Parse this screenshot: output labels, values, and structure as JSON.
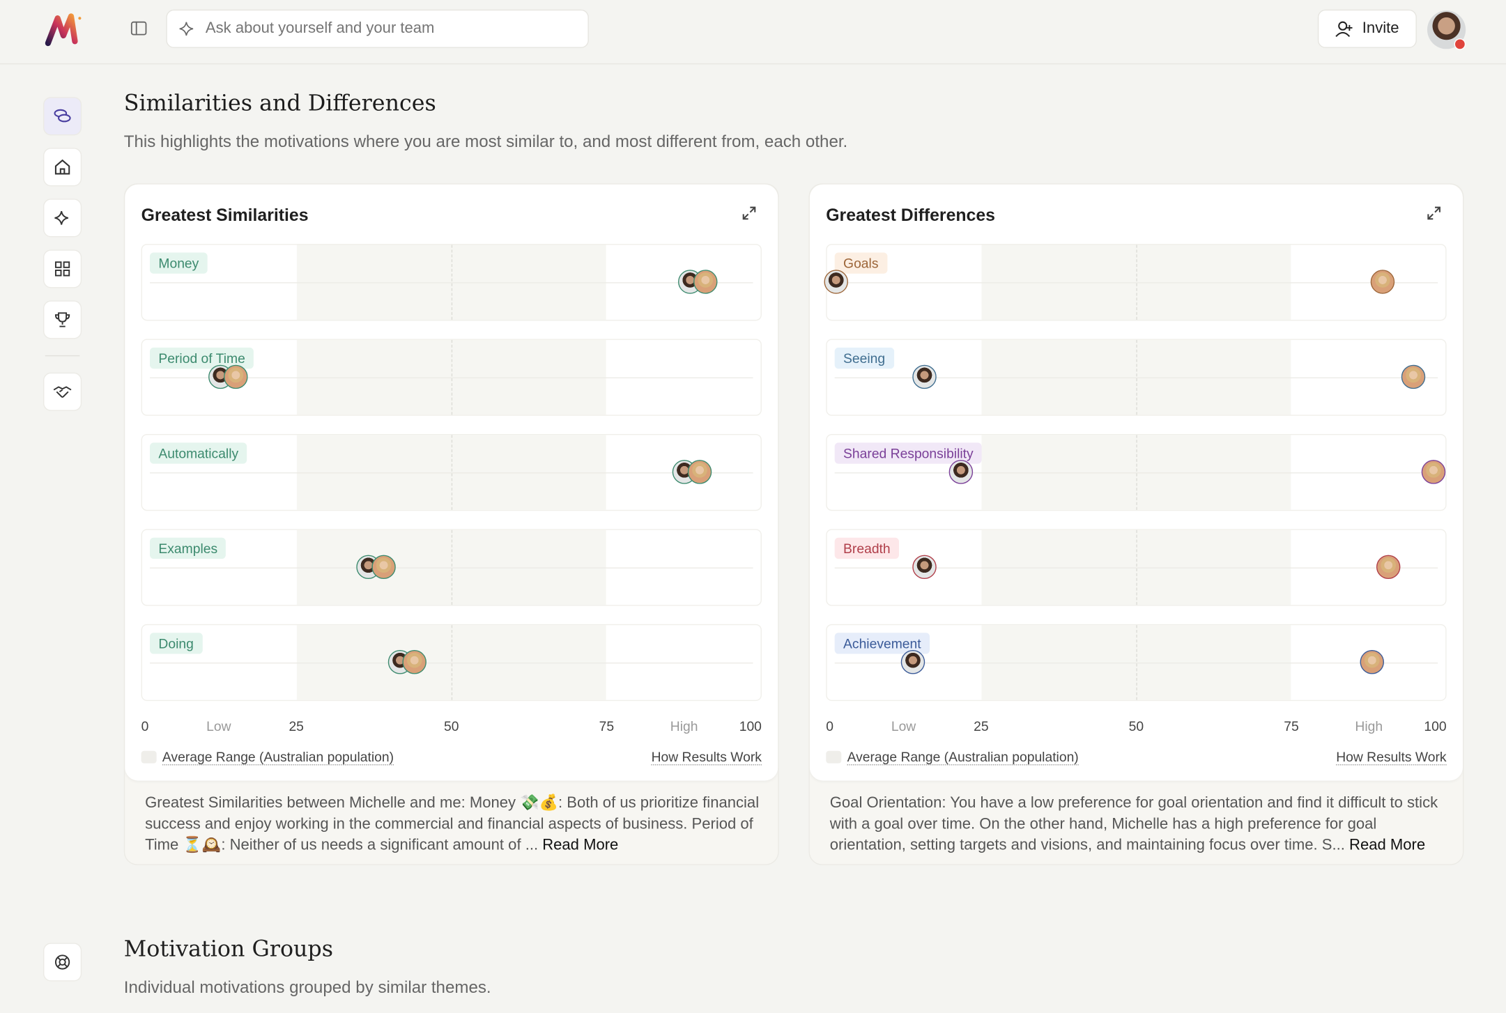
{
  "header": {
    "search_placeholder": "Ask about yourself and your team",
    "invite_label": "Invite"
  },
  "sidebar": {
    "items": [
      {
        "icon": "coins-icon",
        "active": true
      },
      {
        "icon": "home-icon"
      },
      {
        "icon": "sparkle-icon"
      },
      {
        "icon": "grid-icon"
      },
      {
        "icon": "trophy-icon"
      },
      {
        "icon": "handshake-icon"
      },
      {
        "icon": "lifebuoy-icon"
      }
    ]
  },
  "section": {
    "title": "Similarities and Differences",
    "subtitle": "This highlights the motivations where you are most similar to, and most different from, each other."
  },
  "axis": {
    "labels": [
      {
        "text": "0",
        "v": 0
      },
      {
        "text": "Low",
        "v": 12.5,
        "muted": true
      },
      {
        "text": "25",
        "v": 25
      },
      {
        "text": "50",
        "v": 50
      },
      {
        "text": "75",
        "v": 75
      },
      {
        "text": "High",
        "v": 87.5,
        "muted": true
      },
      {
        "text": "100",
        "v": 100
      }
    ],
    "average_range": [
      25,
      75
    ]
  },
  "legend_label": "Average Range (Australian population)",
  "how_label": "How Results Work",
  "read_more": "Read More",
  "cards": [
    {
      "title": "Greatest Similarities",
      "rows": [
        {
          "label": "Money",
          "bg": "#e5f5ee",
          "fg": "#3c8a6e",
          "me": 88.7,
          "michelle": 91.2
        },
        {
          "label": "Period of Time",
          "bg": "#e5f5ee",
          "fg": "#3c8a6e",
          "me": 12.8,
          "michelle": 15.2
        },
        {
          "label": "Automatically",
          "bg": "#e5f5ee",
          "fg": "#3c8a6e",
          "me": 87.8,
          "michelle": 90.2
        },
        {
          "label": "Examples",
          "bg": "#e5f5ee",
          "fg": "#3c8a6e",
          "me": 36.7,
          "michelle": 39.2
        },
        {
          "label": "Doing",
          "bg": "#e5f5ee",
          "fg": "#3c8a6e",
          "me": 41.8,
          "michelle": 44.1
        }
      ],
      "description": "Greatest Similarities between Michelle and me: Money 💸💰: Both of us prioritize financial success and enjoy working in the commercial and financial aspects of business. Period of Time ⏳🕰️: Neither of us needs a significant amount of ..."
    },
    {
      "title": "Greatest Differences",
      "rows": [
        {
          "label": "Goals",
          "bg": "#fcefe3",
          "fg": "#9c6538",
          "me": 1.5,
          "michelle": 89.9
        },
        {
          "label": "Seeing",
          "bg": "#e5f1fa",
          "fg": "#3f6d8f",
          "me": 15.8,
          "michelle": 94.9
        },
        {
          "label": "Shared Responsibility",
          "bg": "#f1e8f7",
          "fg": "#7a3f98",
          "me": 21.8,
          "michelle": 98.1
        },
        {
          "label": "Breadth",
          "bg": "#fde7e9",
          "fg": "#b03f4a",
          "me": 15.8,
          "michelle": 90.9
        },
        {
          "label": "Achievement",
          "bg": "#e6edfa",
          "fg": "#3a5a98",
          "me": 13.9,
          "michelle": 88.2
        }
      ],
      "description": "Goal Orientation: You have a low preference for goal orientation and find it difficult to stick with a goal over time. On the other hand, Michelle has a high preference for goal orientation, setting targets and visions, and maintaining focus over time. S..."
    }
  ],
  "section2": {
    "title": "Motivation Groups",
    "subtitle": "Individual motivations grouped by similar themes."
  }
}
